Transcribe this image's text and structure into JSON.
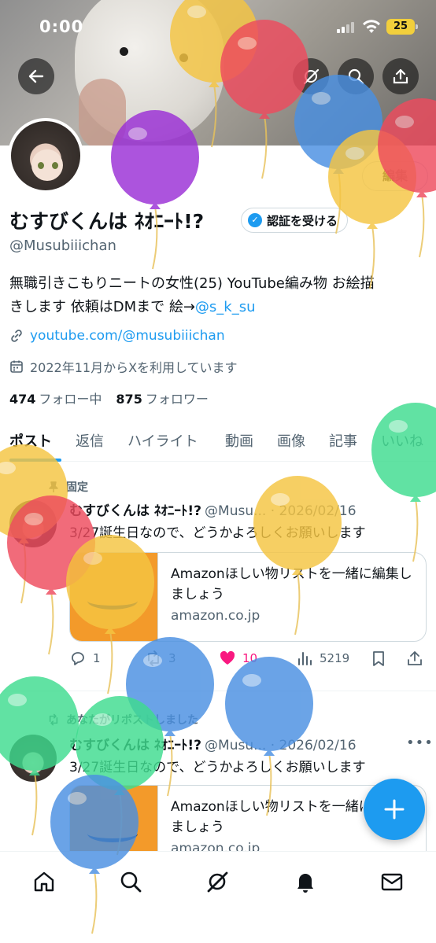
{
  "status_bar": {
    "time": "0:00",
    "battery": "25"
  },
  "profile": {
    "edit_label": "編集",
    "display_name": "むすびくんは ﾈｵﾆｰﾄ!?",
    "verify_label": "認証を受ける",
    "handle": "@Musubiiichan",
    "bio_line1": "無職引きこもりニートの女性(25) YouTube編み物 お絵描",
    "bio_line2_prefix": "きします 依頼はDMまで 絵→",
    "bio_mention": "@s_k_su",
    "link": "youtube.com/@musubiiichan",
    "joined": "2022年11月からXを利用しています",
    "following_count": "474",
    "following_label": "フォロー中",
    "followers_count": "875",
    "followers_label": "フォロワー"
  },
  "tabs": [
    "ポスト",
    "返信",
    "ハイライト",
    "動画",
    "画像",
    "記事",
    "いいね"
  ],
  "posts": [
    {
      "label": "固定",
      "name": "むすびくんは ﾈｵﾆｰﾄ!?",
      "meta": "@Musu... · 2026/02/16",
      "text": "3/27誕生日なので、どうかよろしくお願いします",
      "card_title": "Amazonほしい物リストを一緒に編集しましょう",
      "card_domain": "amazon.co.jp",
      "replies": "1",
      "reposts": "3",
      "likes": "10",
      "views": "5219"
    },
    {
      "label": "あなたがリポストしました",
      "name": "むすびくんは ﾈｵﾆｰﾄ!?",
      "meta": "@Musu... · 2026/02/16",
      "text": "3/27誕生日なので、どうかよろしくお願いします",
      "card_title": "Amazonほしい物リストを一緒に編集しましょう",
      "card_domain": "amazon.co.jp"
    }
  ],
  "fab_label": "+",
  "icons": {
    "back": "arrow-left-icon",
    "grok": "grok-icon",
    "search": "search-icon",
    "share": "share-icon",
    "home": "home-icon",
    "notifications": "bell-icon",
    "messages": "mail-icon"
  },
  "colors": {
    "accent": "#1d9bf0",
    "like": "#f91880",
    "text": "#0f1419",
    "muted": "#536471"
  }
}
